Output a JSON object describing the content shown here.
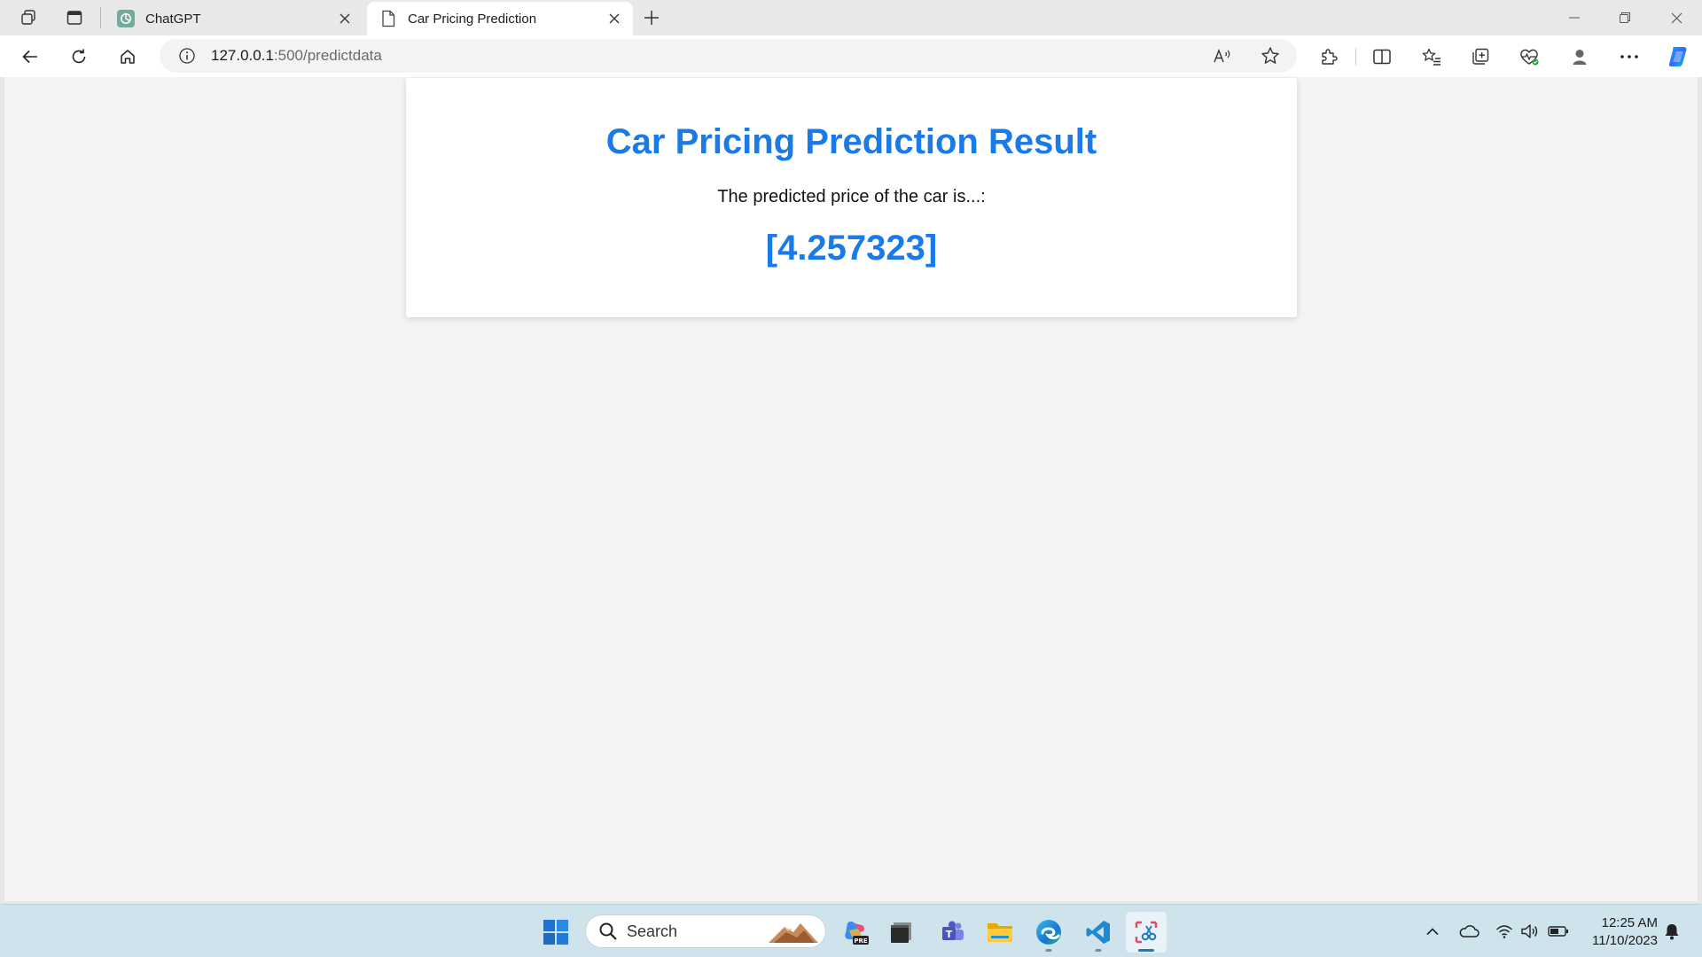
{
  "browser": {
    "tabs": [
      {
        "title": "ChatGPT",
        "favicon": "chatgpt-icon",
        "active": false
      },
      {
        "title": "Car Pricing Prediction",
        "favicon": "page-icon",
        "active": true
      }
    ],
    "address": {
      "host": "127.0.0.1",
      "path": ":500/predictdata"
    }
  },
  "page": {
    "title": "Car Pricing Prediction Result",
    "subtitle": "The predicted price of the car is...:",
    "value": "[4.257323]",
    "accent_color": "#1a7ae8"
  },
  "taskbar": {
    "search_label": "Search",
    "time": "12:25 AM",
    "date": "11/10/2023",
    "pinned": [
      "windows-start-icon",
      "copilot-app-icon",
      "terminal-icon",
      "teams-icon",
      "file-explorer-icon",
      "edge-icon",
      "vscode-icon",
      "snipping-tool-icon"
    ],
    "tray": [
      "chevron-up-icon",
      "onedrive-icon",
      "wifi-icon",
      "volume-icon",
      "battery-icon",
      "notification-bell-icon"
    ]
  }
}
